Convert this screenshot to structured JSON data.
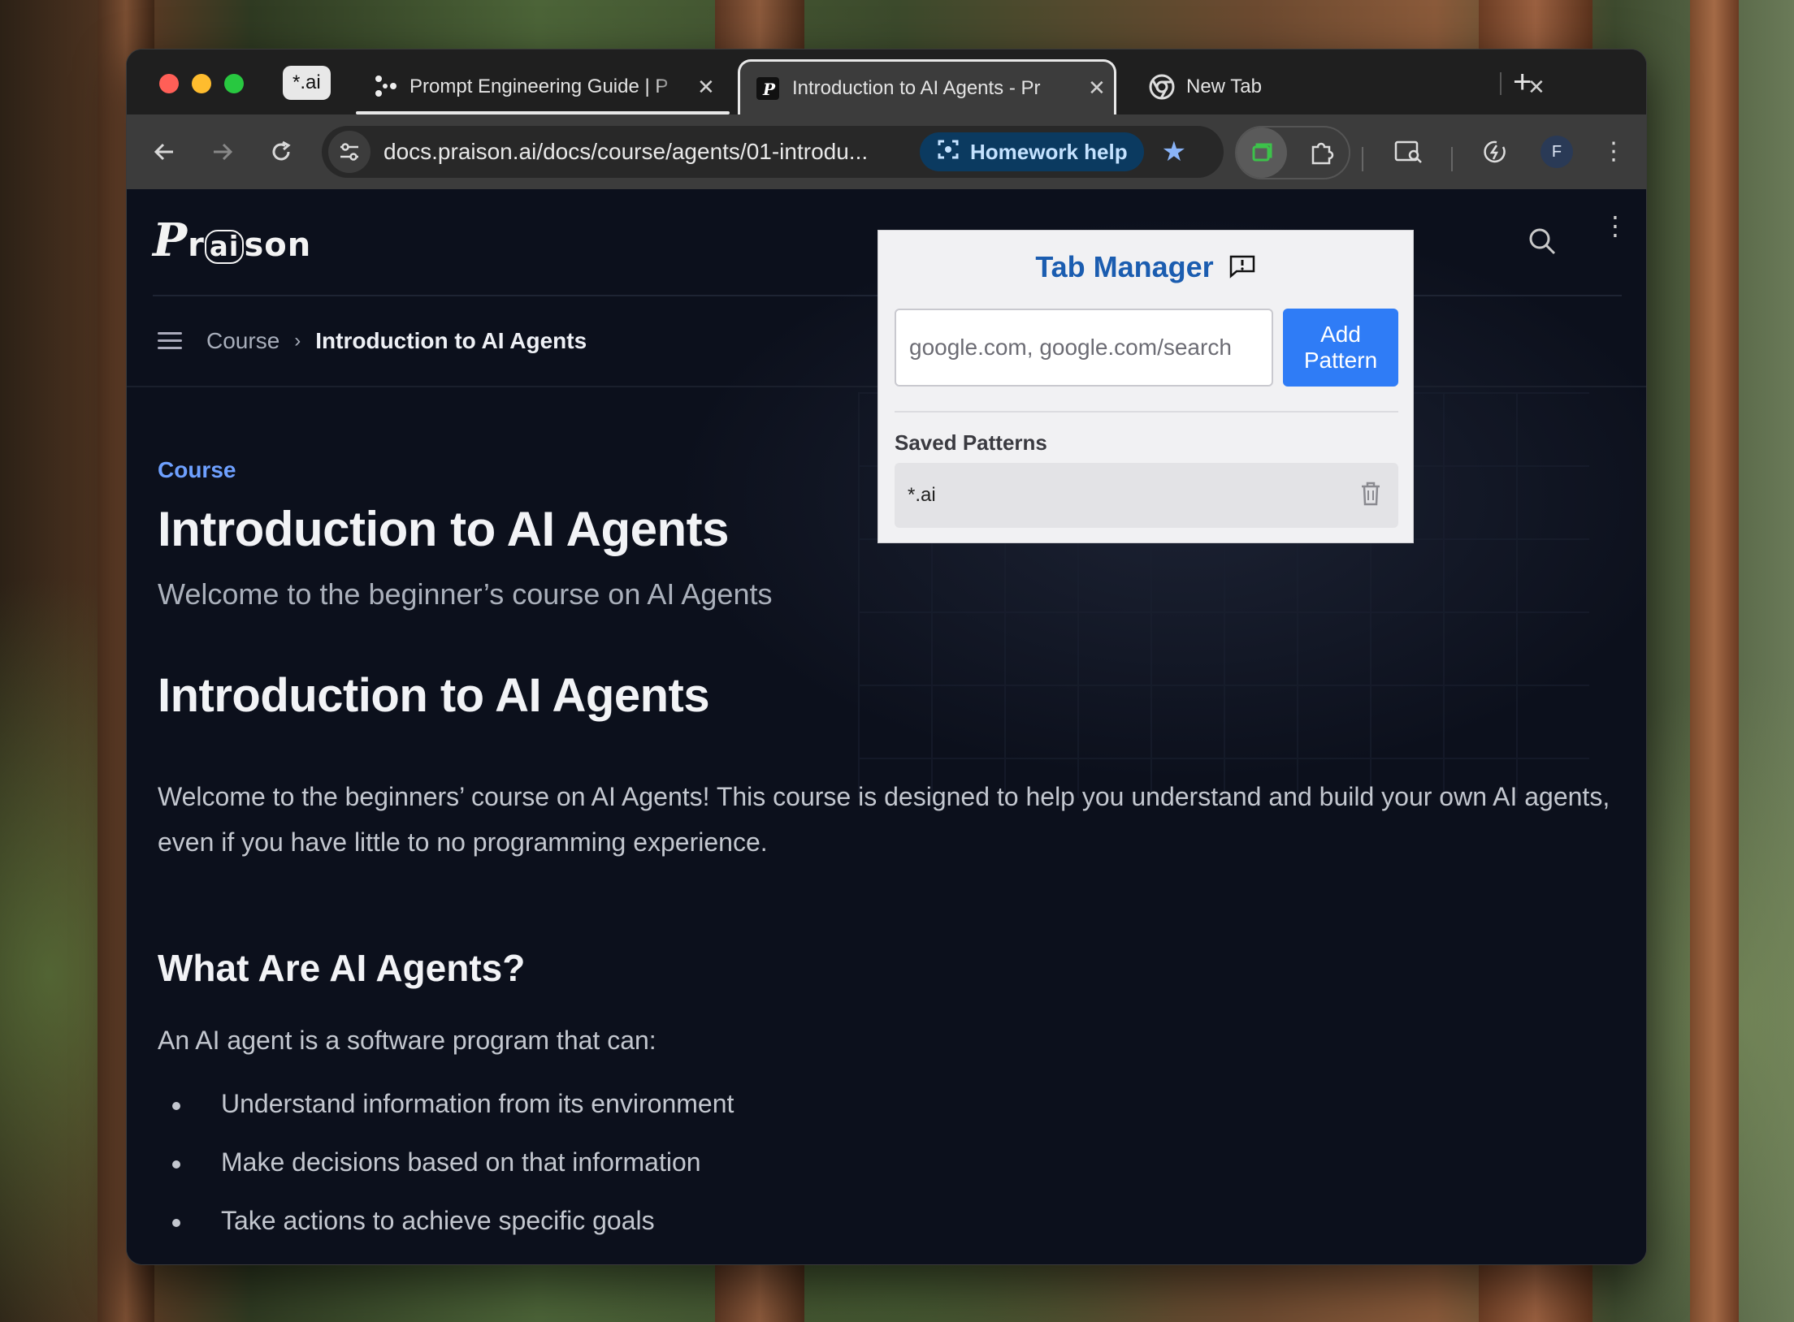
{
  "browser": {
    "tab_group_label": "*.ai",
    "tabs": [
      {
        "title": "Prompt Engineering Guide | P",
        "icon": "prompt-guide-icon"
      },
      {
        "title": "Introduction to AI Agents - Pr",
        "icon": "praison-p-icon",
        "active": true
      },
      {
        "title": "New Tab",
        "icon": "chrome-icon"
      }
    ],
    "address": "docs.praison.ai/docs/course/agents/01-introdu...",
    "homework_chip": "Homework help",
    "profile_initial": "F"
  },
  "site": {
    "logo_prefix": "P",
    "logo_mid": "r",
    "logo_ai": "ai",
    "logo_suffix": "son",
    "breadcrumb": [
      "Course",
      "Introduction to AI Agents"
    ],
    "breadcrumb_sep": "›"
  },
  "article": {
    "kicker": "Course",
    "title": "Introduction to AI Agents",
    "subtitle": "Welcome to the beginner’s course on AI Agents",
    "h1": "Introduction to AI Agents",
    "intro": "Welcome to the beginners’ course on AI Agents! This course is designed to help you understand and build your own AI agents, even if you have little to no programming experience.",
    "h2": "What Are AI Agents?",
    "p2": "An AI agent is a software program that can:",
    "bullets": [
      "Understand information from its environment",
      "Make decisions based on that information",
      "Take actions to achieve specific goals"
    ]
  },
  "popup": {
    "title": "Tab Manager",
    "input_placeholder": "google.com, google.com/search",
    "add_button": "Add Pattern",
    "saved_heading": "Saved Patterns",
    "patterns": [
      "*.ai"
    ]
  },
  "colors": {
    "accent_blue": "#2f7cf6",
    "popup_title": "#1b5db0",
    "kicker": "#6ea0ff"
  }
}
